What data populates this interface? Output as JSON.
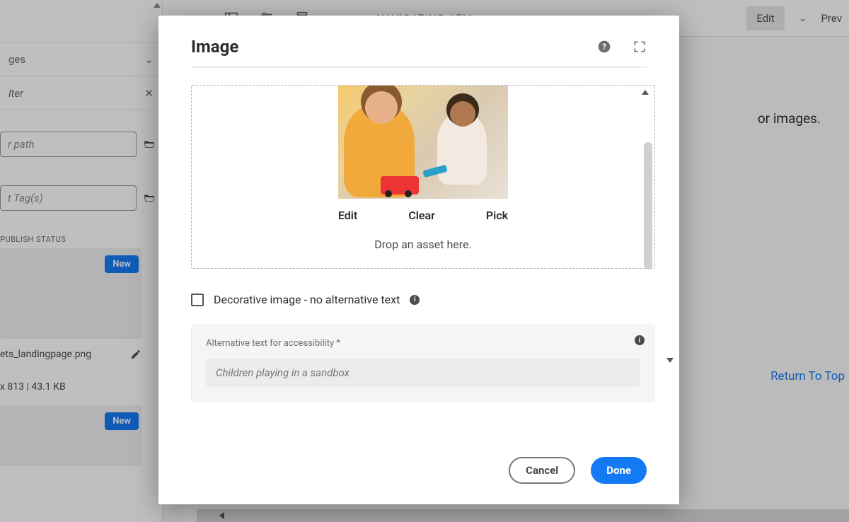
{
  "topbar": {
    "page_title": "NAVIGATING AEM",
    "edit_label": "Edit",
    "preview_label": "Prev"
  },
  "sidebar": {
    "dropdown_label": "ges",
    "filter_placeholder": "lter",
    "path_placeholder": "r path",
    "tags_placeholder": "t Tag(s)",
    "publish_status_label": "PUBLISH STATUS",
    "thumb1_badge": "New",
    "thumb1_name": "ets_landingpage.png",
    "thumb1_meta": " x 813 | 43.1 KB",
    "thumb2_badge": "New"
  },
  "content": {
    "fragment_text": "or images.",
    "return_link": "Return To Top"
  },
  "modal": {
    "title": "Image",
    "actions": {
      "edit": "Edit",
      "clear": "Clear",
      "pick": "Pick"
    },
    "drop_hint": "Drop an asset here.",
    "decorative_label": "Decorative image - no alternative text",
    "alt_label": "Alternative text for accessibility *",
    "alt_value": "Children playing in a sandbox",
    "cancel": "Cancel",
    "done": "Done"
  }
}
